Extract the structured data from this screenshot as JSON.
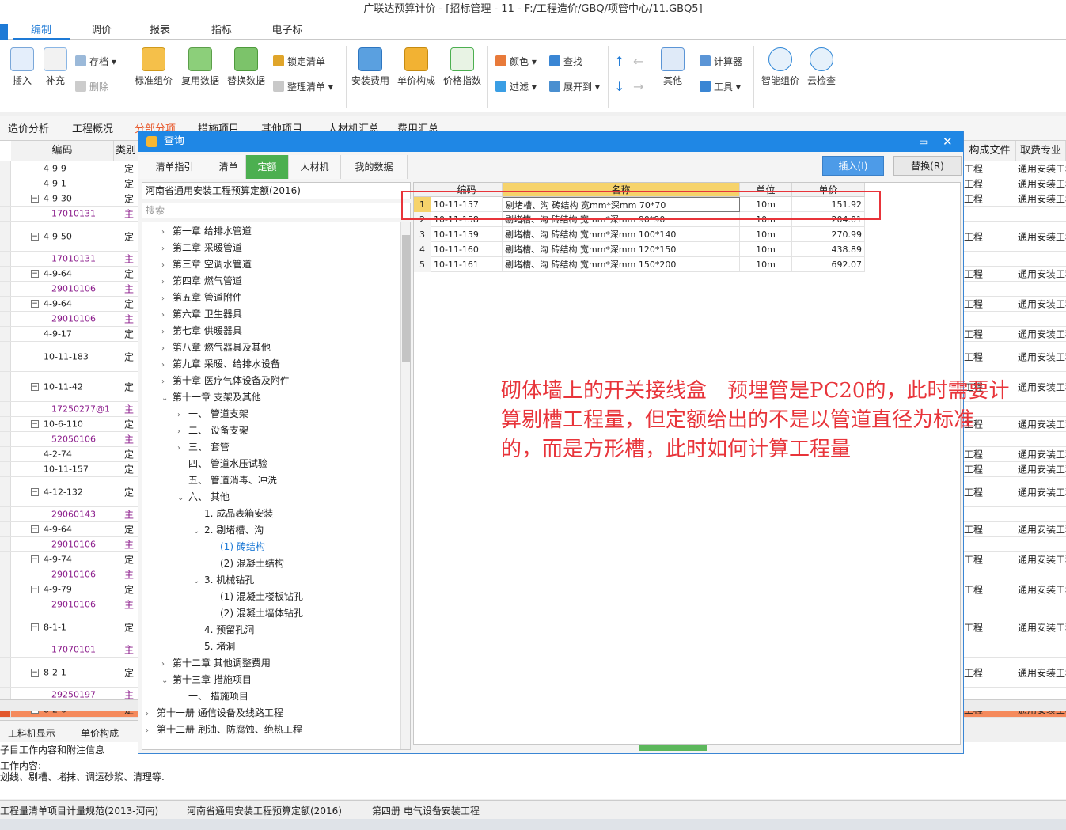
{
  "window": {
    "title": "广联达预算计价 - [招标管理 - 11 - F:/工程造价/GBQ/项管中心/11.GBQ5]"
  },
  "ribbon_tabs": [
    "编制",
    "调价",
    "报表",
    "指标",
    "电子标"
  ],
  "ribbon": {
    "insert": "插入",
    "supplement": "补充",
    "save": "存档",
    "delete": "删除",
    "std_price": "标准组价",
    "reuse": "复用数据",
    "replace_data": "替换数据",
    "lock_list": "锁定清单",
    "organize_list": "整理清单",
    "install_fee": "安装费用",
    "unit_compose": "单价构成",
    "price_index": "价格指数",
    "color": "颜色",
    "find": "查找",
    "filter": "过滤",
    "expand": "展开到",
    "other": "其他",
    "calculator": "计算器",
    "tools": "工具",
    "smart_price": "智能组价",
    "cloud_check": "云检查"
  },
  "subtabs": [
    "造价分析",
    "工程概况",
    "分部分项",
    "措施项目",
    "其他项目",
    "人材机汇总",
    "费用汇总"
  ],
  "left_grid": {
    "headers": [
      "编码",
      "类别"
    ],
    "rows": [
      {
        "code": "4-9-9",
        "type": "定",
        "sub": false
      },
      {
        "code": "4-9-1",
        "type": "定",
        "sub": false
      },
      {
        "code": "4-9-30",
        "type": "定",
        "sub": false,
        "box": "−"
      },
      {
        "code": "17010131",
        "type": "主",
        "sub": true
      },
      {
        "code": "4-9-50",
        "type": "定",
        "sub": false,
        "box": "−"
      },
      {
        "code": "17010131",
        "type": "主",
        "sub": true
      },
      {
        "code": "4-9-64",
        "type": "定",
        "sub": false,
        "box": "−"
      },
      {
        "code": "29010106",
        "type": "主",
        "sub": true
      },
      {
        "code": "4-9-64",
        "type": "定",
        "sub": false,
        "box": "−"
      },
      {
        "code": "29010106",
        "type": "主",
        "sub": true
      },
      {
        "code": "4-9-17",
        "type": "定",
        "sub": false
      },
      {
        "code": "10-11-183",
        "type": "定",
        "sub": false
      },
      {
        "code": "10-11-42",
        "type": "定",
        "sub": false,
        "box": "−"
      },
      {
        "code": "17250277@1",
        "type": "主",
        "sub": true
      },
      {
        "code": "10-6-110",
        "type": "定",
        "sub": false,
        "box": "−"
      },
      {
        "code": "52050106",
        "type": "主",
        "sub": true
      },
      {
        "code": "4-2-74",
        "type": "定",
        "sub": false
      },
      {
        "code": "10-11-157",
        "type": "定",
        "sub": false
      },
      {
        "code": "4-12-132",
        "type": "定",
        "sub": false,
        "box": "−"
      },
      {
        "code": "29060143",
        "type": "主",
        "sub": true
      },
      {
        "code": "4-9-64",
        "type": "定",
        "sub": false,
        "box": "−"
      },
      {
        "code": "29010106",
        "type": "主",
        "sub": true
      },
      {
        "code": "4-9-74",
        "type": "定",
        "sub": false,
        "box": "−"
      },
      {
        "code": "29010106",
        "type": "主",
        "sub": true
      },
      {
        "code": "4-9-79",
        "type": "定",
        "sub": false,
        "box": "−"
      },
      {
        "code": "29010106",
        "type": "主",
        "sub": true
      },
      {
        "code": "8-1-1",
        "type": "定",
        "sub": false,
        "box": "−"
      },
      {
        "code": "17070101",
        "type": "主",
        "sub": true
      },
      {
        "code": "8-2-1",
        "type": "定",
        "sub": false,
        "box": "−"
      },
      {
        "code": "29250197",
        "type": "主",
        "sub": true
      },
      {
        "code": "8-2-6",
        "type": "定",
        "sub": false,
        "box": "−",
        "hl": true
      }
    ]
  },
  "right_grid": {
    "headers": [
      "构成文件",
      "取费专业"
    ],
    "c1": "工程",
    "c2": "通用安装工程"
  },
  "bottom_tabs": [
    "工料机显示",
    "单价构成"
  ],
  "bottom_info": {
    "line1": "子目工作内容和附注信息",
    "line2": "工作内容:",
    "line3": "划线、剔槽、堵抹、调运砂浆、清理等."
  },
  "status": [
    "工程量清单项目计量规范(2013-河南)",
    "河南省通用安装工程预算定额(2016)",
    "第四册 电气设备安装工程"
  ],
  "dialog": {
    "title": "查询",
    "tabs": [
      "清单指引",
      "清单",
      "定额",
      "人材机",
      "我的数据"
    ],
    "insert_btn": "插入(I)",
    "replace_btn": "替换(R)",
    "library": "河南省通用安装工程预算定额(2016)",
    "search_placeholder": "搜索",
    "tree": [
      {
        "label": "第一章 给排水管道",
        "arrow": ">",
        "indent": 0
      },
      {
        "label": "第二章 采暖管道",
        "arrow": ">",
        "indent": 0
      },
      {
        "label": "第三章 空调水管道",
        "arrow": ">",
        "indent": 0
      },
      {
        "label": "第四章 燃气管道",
        "arrow": ">",
        "indent": 0
      },
      {
        "label": "第五章 管道附件",
        "arrow": ">",
        "indent": 0
      },
      {
        "label": "第六章 卫生器具",
        "arrow": ">",
        "indent": 0
      },
      {
        "label": "第七章 供暖器具",
        "arrow": ">",
        "indent": 0
      },
      {
        "label": "第八章 燃气器具及其他",
        "arrow": ">",
        "indent": 0
      },
      {
        "label": "第九章 采暖、给排水设备",
        "arrow": ">",
        "indent": 0
      },
      {
        "label": "第十章 医疗气体设备及附件",
        "arrow": ">",
        "indent": 0
      },
      {
        "label": "第十一章 支架及其他",
        "arrow": "v",
        "indent": 0
      },
      {
        "label": "一、 管道支架",
        "arrow": ">",
        "indent": 1
      },
      {
        "label": "二、 设备支架",
        "arrow": ">",
        "indent": 1
      },
      {
        "label": "三、 套管",
        "arrow": ">",
        "indent": 1
      },
      {
        "label": "四、 管道水压试验",
        "arrow": "",
        "indent": 1
      },
      {
        "label": "五、 管道消毒、冲洗",
        "arrow": "",
        "indent": 1
      },
      {
        "label": "六、 其他",
        "arrow": "v",
        "indent": 1
      },
      {
        "label": "1. 成品表箱安装",
        "arrow": "",
        "indent": 2
      },
      {
        "label": "2. 剔堵槽、沟",
        "arrow": "v",
        "indent": 2
      },
      {
        "label": "(1) 砖结构",
        "arrow": "",
        "indent": 3,
        "sel": true
      },
      {
        "label": "(2) 混凝土结构",
        "arrow": "",
        "indent": 3
      },
      {
        "label": "3. 机械钻孔",
        "arrow": "v",
        "indent": 2
      },
      {
        "label": "(1) 混凝土楼板钻孔",
        "arrow": "",
        "indent": 3
      },
      {
        "label": "(2) 混凝土墙体钻孔",
        "arrow": "",
        "indent": 3
      },
      {
        "label": "4. 预留孔洞",
        "arrow": "",
        "indent": 2
      },
      {
        "label": "5. 堵洞",
        "arrow": "",
        "indent": 2
      },
      {
        "label": "第十二章 其他调整费用",
        "arrow": ">",
        "indent": 0
      },
      {
        "label": "第十三章 措施项目",
        "arrow": "v",
        "indent": 0
      },
      {
        "label": "一、 措施项目",
        "arrow": "",
        "indent": 1
      },
      {
        "label": "第十一册 通信设备及线路工程",
        "arrow": ">",
        "indent": -1
      },
      {
        "label": "第十二册 刷油、防腐蚀、绝热工程",
        "arrow": ">",
        "indent": -1
      }
    ],
    "results_headers": [
      "编码",
      "名称",
      "单位",
      "单价"
    ],
    "results": [
      {
        "n": "1",
        "code": "10-11-157",
        "name": "剔堵槽、沟 砖结构 宽mm*深mm 70*70",
        "unit": "10m",
        "price": "151.92"
      },
      {
        "n": "2",
        "code": "10-11-158",
        "name": "剔堵槽、沟 砖结构 宽mm*深mm 90*90",
        "unit": "10m",
        "price": "204.01"
      },
      {
        "n": "3",
        "code": "10-11-159",
        "name": "剔堵槽、沟 砖结构 宽mm*深mm 100*140",
        "unit": "10m",
        "price": "270.99"
      },
      {
        "n": "4",
        "code": "10-11-160",
        "name": "剔堵槽、沟 砖结构 宽mm*深mm 120*150",
        "unit": "10m",
        "price": "438.89"
      },
      {
        "n": "5",
        "code": "10-11-161",
        "name": "剔堵槽、沟 砖结构 宽mm*深mm 150*200",
        "unit": "10m",
        "price": "692.07"
      }
    ],
    "annotation": [
      "砌体墙上的开关接线盒　预埋管是PC20的，此时需要计",
      "算剔槽工程量，但定额给出的不是以管道直径为标准",
      "的，而是方形槽，此时如何计算工程量"
    ]
  },
  "colors": {
    "accent": "#1f87e5",
    "active_tab": "#4caf50",
    "annotation": "#e8343a",
    "highlight_row": "#f58a5c"
  }
}
